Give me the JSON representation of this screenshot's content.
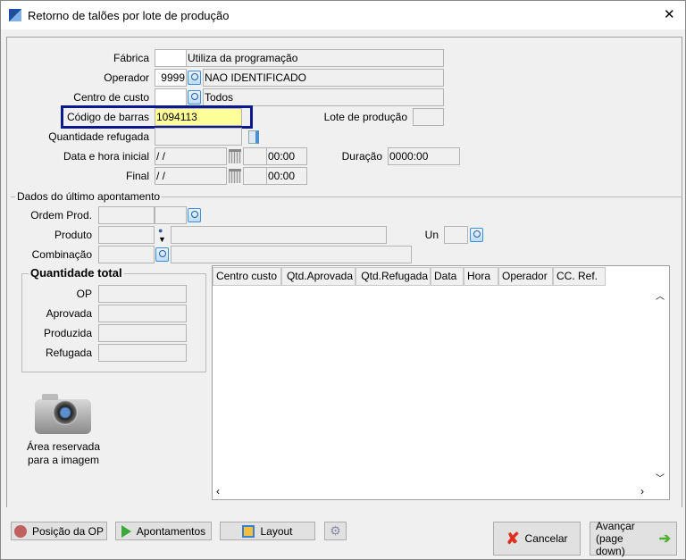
{
  "window": {
    "title": "Retorno de talões por lote de produção",
    "close": "✕"
  },
  "form": {
    "fabrica": {
      "label": "Fábrica",
      "code": "",
      "desc": "Utiliza da programação"
    },
    "operador": {
      "label": "Operador",
      "code": "9999",
      "desc": "NAO IDENTIFICADO"
    },
    "centro": {
      "label": "Centro de custo",
      "code": "",
      "desc": "Todos"
    },
    "codigo": {
      "label": "Código de barras",
      "value": "1094113"
    },
    "lote": {
      "label": "Lote de produção",
      "value": ""
    },
    "qtd_ref": {
      "label": "Quantidade refugada",
      "value": ""
    },
    "inicial": {
      "label": "Data e hora inicial",
      "date": " /  /",
      "time": "00:00"
    },
    "final": {
      "label": "Final",
      "date": " /  /",
      "time": "00:00"
    },
    "duracao": {
      "label": "Duração",
      "value": "0000:00"
    }
  },
  "last": {
    "title": "Dados do último apontamento",
    "ordem": {
      "label": "Ordem Prod."
    },
    "produto": {
      "label": "Produto"
    },
    "un": {
      "label": "Un"
    },
    "combinacao": {
      "label": "Combinação"
    }
  },
  "totals": {
    "title": "Quantidade total",
    "rows": [
      "OP",
      "Aprovada",
      "Produzida",
      "Refugada"
    ]
  },
  "grid": {
    "columns": [
      "Centro custo",
      "Qtd.Aprovada",
      "Qtd.Refugada",
      "Data",
      "Hora",
      "Operador",
      "CC. Ref."
    ]
  },
  "image_area": {
    "line1": "Área reservada",
    "line2": "para a imagem"
  },
  "buttons": {
    "posicao": "Posição da OP",
    "apontamentos": "Apontamentos",
    "layout": "Layout",
    "cancelar": "Cancelar",
    "avancar1": "Avançar",
    "avancar2": "(page down)"
  },
  "colors": {
    "highlight_border": "#0a1a8c",
    "active_input": "#ffff99"
  }
}
